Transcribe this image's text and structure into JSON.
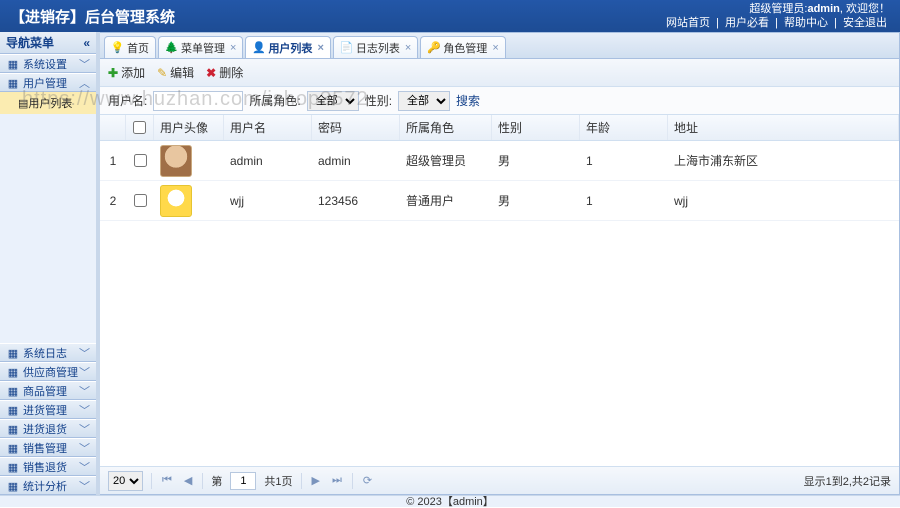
{
  "header": {
    "title": "【进销存】后台管理系统",
    "admin_label": "超级管理员:",
    "admin_name": "admin",
    "welcome": ", 欢迎您！",
    "links": [
      "网站首页",
      "用户必看",
      "帮助中心",
      "安全退出"
    ]
  },
  "nav": {
    "title": "导航菜单",
    "items": [
      {
        "label": "系统设置",
        "icon": "gear"
      },
      {
        "label": "用户管理",
        "icon": "user",
        "expanded": true,
        "children": [
          {
            "label": "用户列表",
            "selected": true
          }
        ]
      },
      {
        "label": "系统日志",
        "icon": "log"
      },
      {
        "label": "供应商管理",
        "icon": "supplier"
      },
      {
        "label": "商品管理",
        "icon": "goods"
      },
      {
        "label": "进货管理",
        "icon": "in"
      },
      {
        "label": "进货退货",
        "icon": "inret"
      },
      {
        "label": "销售管理",
        "icon": "sale"
      },
      {
        "label": "销售退货",
        "icon": "saleret"
      },
      {
        "label": "统计分析",
        "icon": "chart"
      }
    ]
  },
  "tabs": [
    {
      "label": "首页",
      "icon": "bulb",
      "closable": false
    },
    {
      "label": "菜单管理",
      "icon": "tree",
      "closable": true
    },
    {
      "label": "用户列表",
      "icon": "user",
      "closable": true,
      "active": true
    },
    {
      "label": "日志列表",
      "icon": "log",
      "closable": true
    },
    {
      "label": "角色管理",
      "icon": "role",
      "closable": true
    }
  ],
  "toolbar": {
    "add": "添加",
    "edit": "编辑",
    "del": "删除"
  },
  "search": {
    "name_label": "用户名:",
    "name_value": "",
    "role_label": "所属角色:",
    "role_value": "全部",
    "sex_label": "性别:",
    "sex_value": "全部",
    "submit": "搜索"
  },
  "columns": [
    "",
    "",
    "用户头像",
    "用户名",
    "密码",
    "所属角色",
    "性别",
    "年龄",
    "地址"
  ],
  "rows": [
    {
      "idx": "1",
      "avatar": "av1",
      "username": "admin",
      "password": "admin",
      "role": "超级管理员",
      "sex": "男",
      "age": "1",
      "addr": "上海市浦东新区"
    },
    {
      "idx": "2",
      "avatar": "av2",
      "username": "wjj",
      "password": "123456",
      "role": "普通用户",
      "sex": "男",
      "age": "1",
      "addr": "wjj"
    }
  ],
  "pager": {
    "size": "20",
    "page": "1",
    "total_label": "共1页",
    "info": "显示1到2,共2记录"
  },
  "footer": "© 2023【admin】",
  "watermark": "https://www.huzhan.com/ishop3572"
}
